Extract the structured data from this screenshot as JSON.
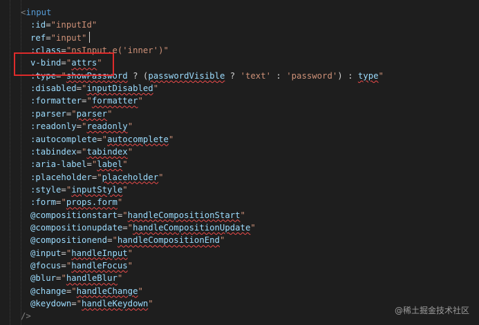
{
  "editor": {
    "lines": [
      {
        "id": "l1",
        "parts": [
          [
            "bracket",
            "<"
          ],
          [
            "tag",
            "input"
          ]
        ]
      },
      {
        "id": "l2",
        "parts": [
          [
            "attr",
            ":id"
          ],
          [
            "punct",
            "="
          ],
          [
            "str",
            "\"inputId\""
          ]
        ]
      },
      {
        "id": "l3",
        "parts": [
          [
            "attr",
            "ref"
          ],
          [
            "punct",
            "="
          ],
          [
            "str",
            "\"input\""
          ]
        ]
      },
      {
        "id": "l4",
        "parts": [
          [
            "attr",
            ":class"
          ],
          [
            "punct",
            "="
          ],
          [
            "str",
            "\"nsInput.e('inner')\""
          ]
        ]
      },
      {
        "id": "l5",
        "parts": [
          [
            "attr",
            "v-bind"
          ],
          [
            "punct",
            "="
          ],
          [
            "str",
            "\""
          ],
          [
            "sq",
            "attrs"
          ],
          [
            "str",
            "\""
          ]
        ]
      },
      {
        "id": "l6",
        "parts": [
          [
            "attr",
            ":type"
          ],
          [
            "punct",
            "="
          ],
          [
            "str",
            "\""
          ],
          [
            "sq",
            "showPassword"
          ],
          [
            "punct",
            " ? ("
          ],
          [
            "sq",
            "passwordVisible"
          ],
          [
            "punct",
            " ? "
          ],
          [
            "str",
            "'text'"
          ],
          [
            "punct",
            " : "
          ],
          [
            "str",
            "'password'"
          ],
          [
            "punct",
            ") : "
          ],
          [
            "sq",
            "type"
          ],
          [
            "str",
            "\""
          ]
        ]
      },
      {
        "id": "l7",
        "parts": [
          [
            "attr",
            ":disabled"
          ],
          [
            "punct",
            "="
          ],
          [
            "str",
            "\""
          ],
          [
            "sq",
            "inputDisabled"
          ],
          [
            "str",
            "\""
          ]
        ]
      },
      {
        "id": "l8",
        "parts": [
          [
            "attr",
            ":formatter"
          ],
          [
            "punct",
            "="
          ],
          [
            "str",
            "\""
          ],
          [
            "sq",
            "formatter"
          ],
          [
            "str",
            "\""
          ]
        ]
      },
      {
        "id": "l9",
        "parts": [
          [
            "attr",
            ":parser"
          ],
          [
            "punct",
            "="
          ],
          [
            "str",
            "\""
          ],
          [
            "sq",
            "parser"
          ],
          [
            "str",
            "\""
          ]
        ]
      },
      {
        "id": "l10",
        "parts": [
          [
            "attr",
            ":readonly"
          ],
          [
            "punct",
            "="
          ],
          [
            "str",
            "\""
          ],
          [
            "sq",
            "readonly"
          ],
          [
            "str",
            "\""
          ]
        ]
      },
      {
        "id": "l11",
        "parts": [
          [
            "attr",
            ":autocomplete"
          ],
          [
            "punct",
            "="
          ],
          [
            "str",
            "\""
          ],
          [
            "sq",
            "autocomplete"
          ],
          [
            "str",
            "\""
          ]
        ]
      },
      {
        "id": "l12",
        "parts": [
          [
            "attr",
            ":tabindex"
          ],
          [
            "punct",
            "="
          ],
          [
            "str",
            "\""
          ],
          [
            "sq",
            "tabindex"
          ],
          [
            "str",
            "\""
          ]
        ]
      },
      {
        "id": "l13",
        "parts": [
          [
            "attr",
            ":aria-label"
          ],
          [
            "punct",
            "="
          ],
          [
            "str",
            "\""
          ],
          [
            "sq",
            "label"
          ],
          [
            "str",
            "\""
          ]
        ]
      },
      {
        "id": "l14",
        "parts": [
          [
            "attr",
            ":placeholder"
          ],
          [
            "punct",
            "="
          ],
          [
            "str",
            "\""
          ],
          [
            "sq",
            "placeholder"
          ],
          [
            "str",
            "\""
          ]
        ]
      },
      {
        "id": "l15",
        "parts": [
          [
            "attr",
            ":style"
          ],
          [
            "punct",
            "="
          ],
          [
            "str",
            "\""
          ],
          [
            "sq",
            "inputStyle"
          ],
          [
            "str",
            "\""
          ]
        ]
      },
      {
        "id": "l16",
        "parts": [
          [
            "attr",
            ":form"
          ],
          [
            "punct",
            "="
          ],
          [
            "str",
            "\""
          ],
          [
            "sq",
            "props.form"
          ],
          [
            "str",
            "\""
          ]
        ]
      },
      {
        "id": "l17",
        "parts": [
          [
            "attr",
            "@compositionstart"
          ],
          [
            "punct",
            "="
          ],
          [
            "str",
            "\""
          ],
          [
            "sq",
            "handleCompositionStart"
          ],
          [
            "str",
            "\""
          ]
        ]
      },
      {
        "id": "l18",
        "parts": [
          [
            "attr",
            "@compositionupdate"
          ],
          [
            "punct",
            "="
          ],
          [
            "str",
            "\""
          ],
          [
            "sq",
            "handleCompositionUpdate"
          ],
          [
            "str",
            "\""
          ]
        ]
      },
      {
        "id": "l19",
        "parts": [
          [
            "attr",
            "@compositionend"
          ],
          [
            "punct",
            "="
          ],
          [
            "str",
            "\""
          ],
          [
            "sq",
            "handleCompositionEnd"
          ],
          [
            "str",
            "\""
          ]
        ]
      },
      {
        "id": "l20",
        "parts": [
          [
            "attr",
            "@input"
          ],
          [
            "punct",
            "="
          ],
          [
            "str",
            "\""
          ],
          [
            "sq",
            "handleInput"
          ],
          [
            "str",
            "\""
          ]
        ]
      },
      {
        "id": "l21",
        "parts": [
          [
            "attr",
            "@focus"
          ],
          [
            "punct",
            "="
          ],
          [
            "str",
            "\""
          ],
          [
            "sq",
            "handleFocus"
          ],
          [
            "str",
            "\""
          ]
        ]
      },
      {
        "id": "l22",
        "parts": [
          [
            "attr",
            "@blur"
          ],
          [
            "punct",
            "="
          ],
          [
            "str",
            "\""
          ],
          [
            "sq",
            "handleBlur"
          ],
          [
            "str",
            "\""
          ]
        ]
      },
      {
        "id": "l23",
        "parts": [
          [
            "attr",
            "@change"
          ],
          [
            "punct",
            "="
          ],
          [
            "str",
            "\""
          ],
          [
            "sq",
            "handleChange"
          ],
          [
            "str",
            "\""
          ]
        ]
      },
      {
        "id": "l24",
        "parts": [
          [
            "attr",
            "@keydown"
          ],
          [
            "punct",
            "="
          ],
          [
            "str",
            "\""
          ],
          [
            "sq",
            "handleKeydown"
          ],
          [
            "str",
            "\""
          ]
        ]
      },
      {
        "id": "l25",
        "parts": [
          [
            "bracket",
            "/>"
          ]
        ]
      }
    ]
  },
  "watermark": "@稀土掘金技术社区",
  "colors": {
    "background": "#1e1e1e",
    "tag": "#569cd6",
    "attribute": "#9cdcfe",
    "string": "#ce9178",
    "highlight_box": "#e02b2b",
    "error_squiggle": "#f14c4c"
  }
}
